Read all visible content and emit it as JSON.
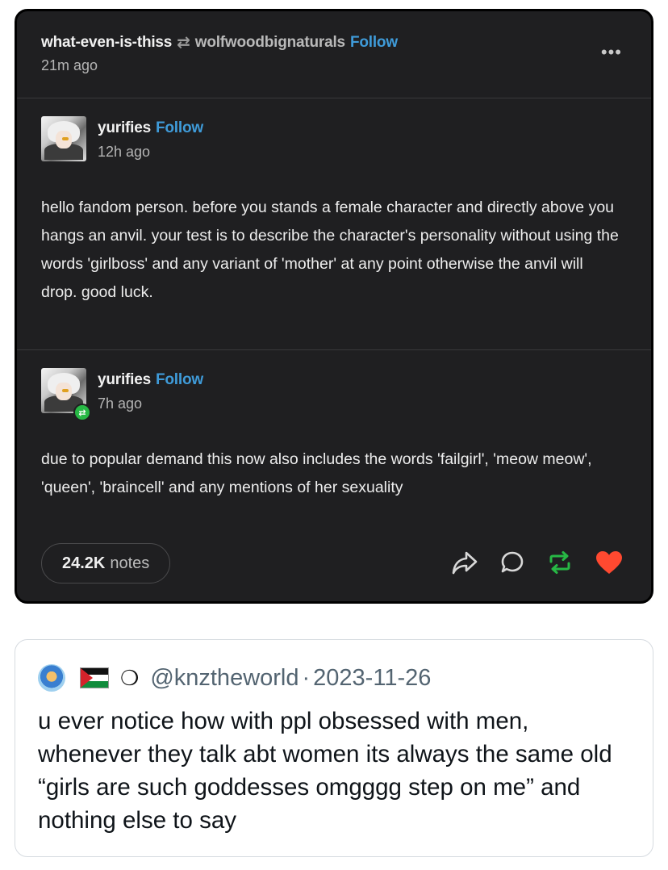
{
  "tumblr": {
    "reblogger": "what-even-is-thiss",
    "reblogged_from": "wolfwoodbignaturals",
    "follow_label": "Follow",
    "time": "21m ago",
    "more_label": "•••",
    "posts": [
      {
        "username": "yurifies",
        "follow_label": "Follow",
        "time": "12h ago",
        "text": "hello fandom person. before you stands a female character and directly above you hangs an anvil. your test is to describe the character's personality without using the words 'girlboss' and any variant of 'mother' at any point otherwise the anvil will drop. good luck."
      },
      {
        "username": "yurifies",
        "follow_label": "Follow",
        "time": "7h ago",
        "text": "due to popular demand this now also includes the words 'failgirl', 'meow meow', 'queen', 'braincell' and any mentions of her sexuality"
      }
    ],
    "notes_count": "24.2K",
    "notes_label": "notes",
    "colors": {
      "follow": "#3f9bd9",
      "reblog": "#27b845",
      "like": "#ff4930"
    }
  },
  "tweet": {
    "handle": "@knztheworld",
    "separator": "·",
    "date": "2023-11-26",
    "moon_glyph": "❍",
    "text": "u ever notice how with ppl obsessed with men, whenever they talk abt women its always the same old “girls are such goddesses omgggg step on me” and nothing else to say"
  }
}
